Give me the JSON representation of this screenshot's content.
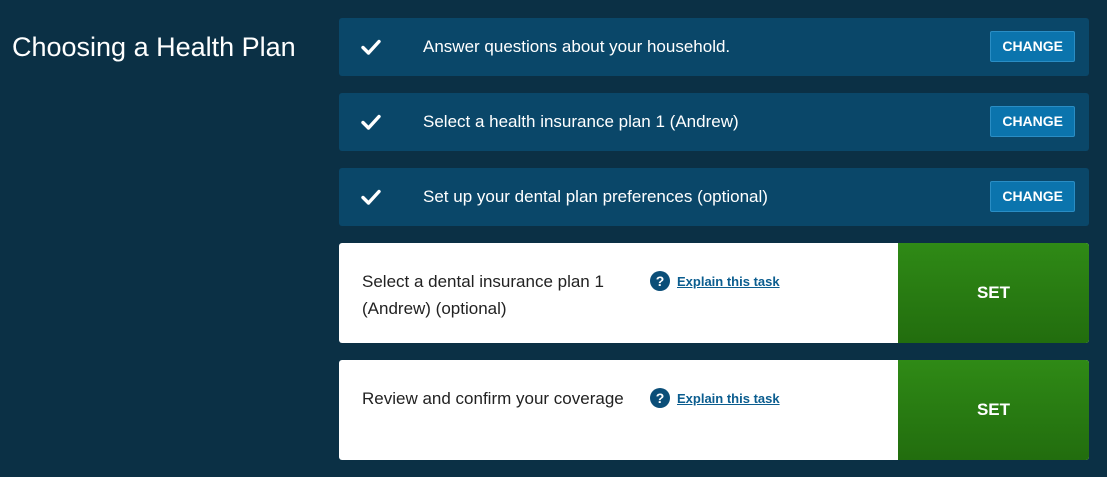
{
  "page": {
    "title": "Choosing a Health Plan"
  },
  "completed_tasks": [
    {
      "label": "Answer questions about your household.",
      "button": "CHANGE",
      "icon": "checkmark-icon"
    },
    {
      "label": "Select a health insurance plan 1 (Andrew)",
      "button": "CHANGE",
      "icon": "checkmark-icon"
    },
    {
      "label": "Set up your dental plan preferences (optional)",
      "button": "CHANGE",
      "icon": "checkmark-icon"
    }
  ],
  "pending_tasks": [
    {
      "label": "Select a dental insurance plan 1 (Andrew) (optional)",
      "help_icon": "?",
      "explain_link": "Explain this task",
      "button": "SET"
    },
    {
      "label": "Review and confirm your coverage",
      "help_icon": "?",
      "explain_link": "Explain this task",
      "button": "SET"
    }
  ],
  "colors": {
    "background": "#0b3045",
    "completed_row": "#0a4769",
    "change_button": "#0b74ad",
    "set_button": "#2a7d13",
    "link": "#0b5d8f"
  }
}
